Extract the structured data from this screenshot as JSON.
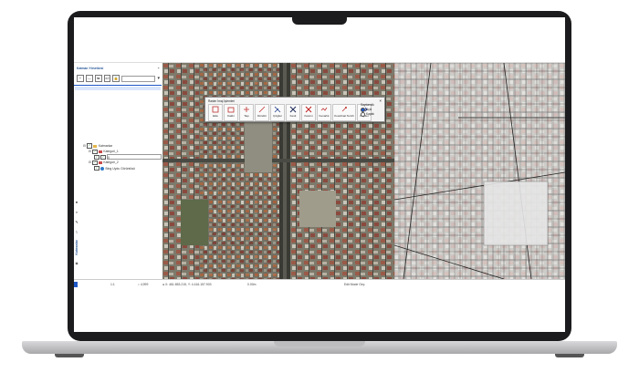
{
  "toc": {
    "title": "Katman Yöneticisi",
    "pin": "+",
    "tools": [
      "+",
      "—",
      "⇆",
      "x2",
      "🔒"
    ],
    "tree": {
      "root": "Katmanlar",
      "cat1": "Kategori_1",
      "cat2": "Kategori_2",
      "layer": "Bing Uydu Görüntüsü",
      "edit_value": "0"
    },
    "side_label": "Katmanlar"
  },
  "panel": {
    "title": "Raster İmaj İşlemleri",
    "close": "×",
    "tools": [
      {
        "label": "Ekle",
        "icon": "add-raster-icon"
      },
      {
        "label": "Kaldır",
        "icon": "remove-raster-icon"
      },
      {
        "label": "Taşı",
        "icon": "move-raster-icon"
      },
      {
        "label": "Döndür",
        "icon": "rotate-raster-icon"
      },
      {
        "label": "Çizgiler",
        "icon": "lines-icon"
      },
      {
        "label": "Kesit",
        "icon": "clip-icon"
      },
      {
        "label": "Kesimi",
        "icon": "crop-icon"
      },
      {
        "label": "Kenarlık",
        "icon": "border-icon"
      },
      {
        "label": "Koordinat Tercih",
        "icon": "coordinate-icon"
      },
      {
        "label": "Kaydet",
        "icon": "save-raster-icon"
      }
    ],
    "options_label": "Saydamlık",
    "option_a": "Açık",
    "option_b": "Kapalı"
  },
  "status": {
    "scale": "1:1",
    "zoom": "4,999",
    "coords": "X: 461.853.215, Y: 4.416.157.903",
    "measure": "0.00m",
    "mode": "Edit Mode Geç"
  },
  "colors": {
    "accent": "#1e57c8",
    "title_blue": "#2a5a9a"
  }
}
